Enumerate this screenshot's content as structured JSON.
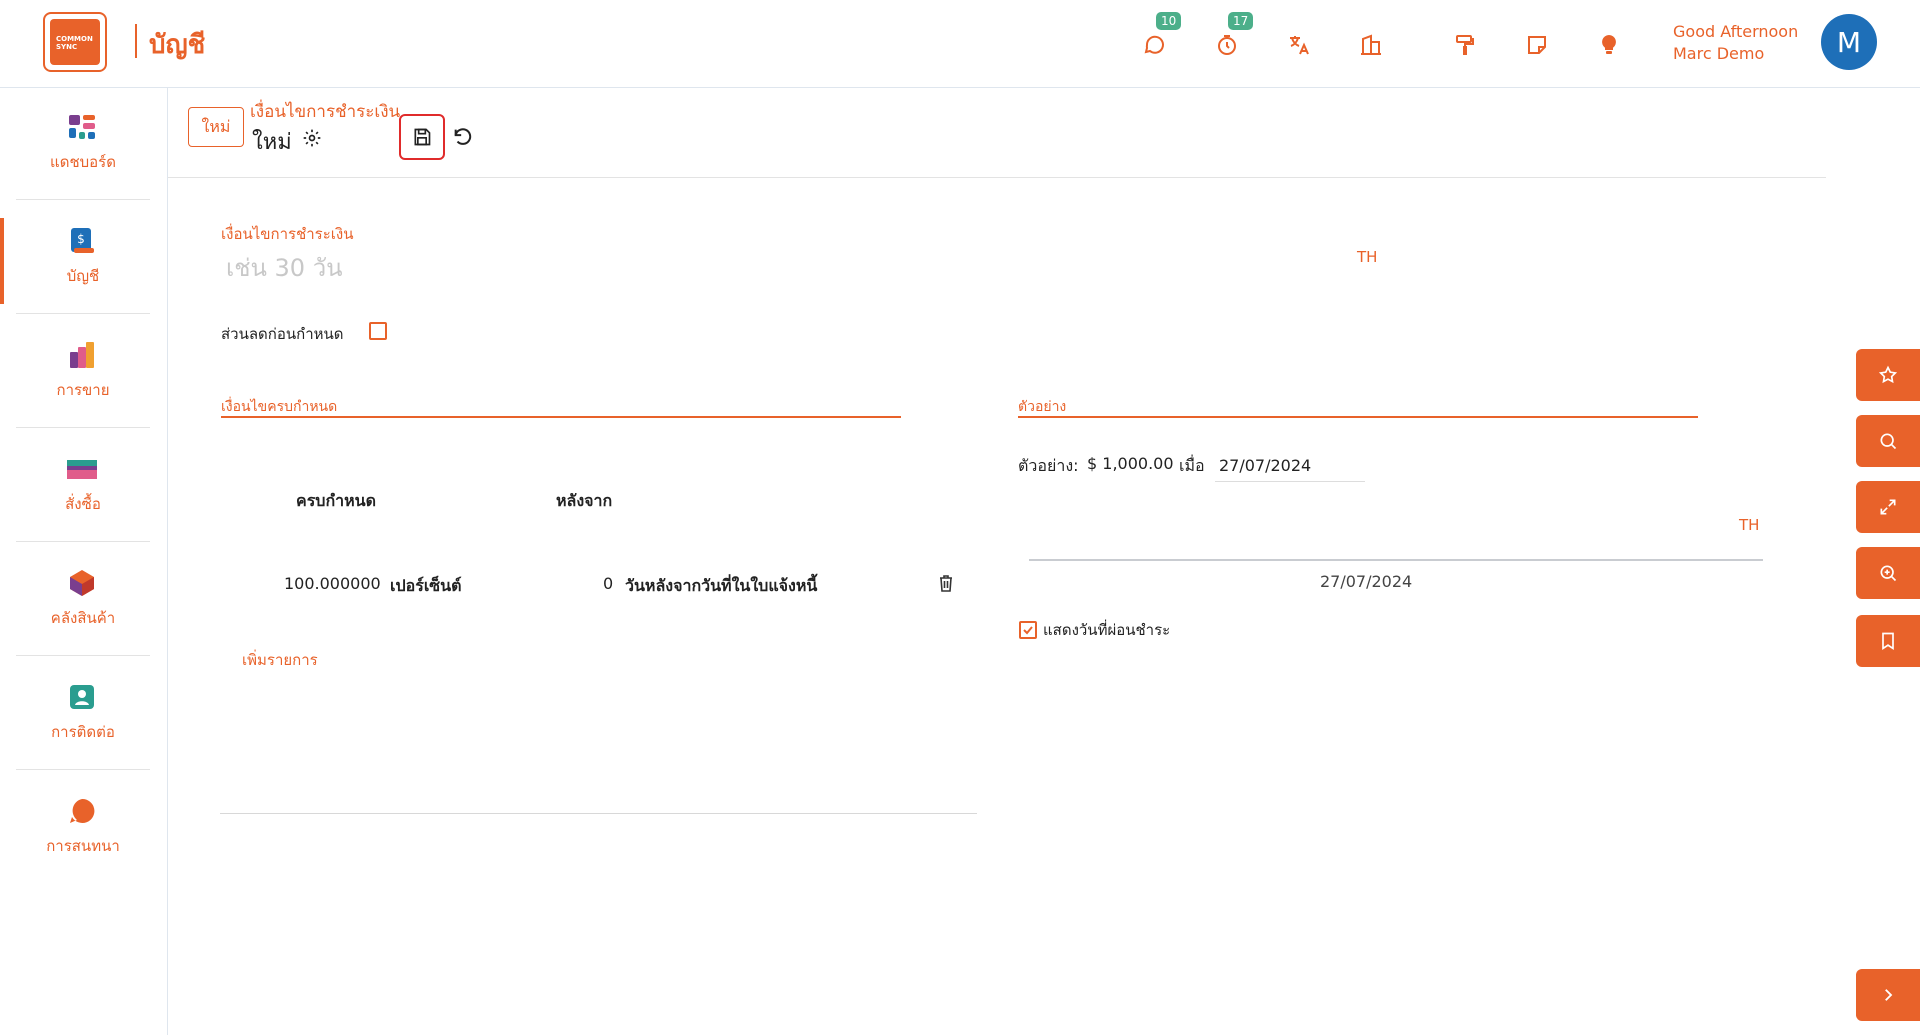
{
  "app": {
    "logo_text": "COMMON SYNC",
    "module_title": "บัญชี"
  },
  "topbar": {
    "icons": [
      {
        "name": "chat-icon",
        "badge": "10"
      },
      {
        "name": "timer-icon",
        "badge": "17"
      },
      {
        "name": "translate-icon",
        "badge": ""
      },
      {
        "name": "company-icon",
        "badge": ""
      },
      {
        "name": "paint-roller-icon",
        "badge": ""
      },
      {
        "name": "sticky-note-icon",
        "badge": ""
      },
      {
        "name": "lightbulb-icon",
        "badge": ""
      }
    ],
    "greeting": "Good Afternoon",
    "user_name": "Marc Demo",
    "avatar_letter": "M"
  },
  "sidebar": {
    "items": [
      {
        "label": "แดชบอร์ด",
        "icon": "dashboard-icon"
      },
      {
        "label": "บัญชี",
        "icon": "accounting-icon"
      },
      {
        "label": "การขาย",
        "icon": "sales-icon"
      },
      {
        "label": "สั่งซื้อ",
        "icon": "purchase-icon"
      },
      {
        "label": "คลังสินค้า",
        "icon": "inventory-icon"
      },
      {
        "label": "การติดต่อ",
        "icon": "contacts-icon"
      },
      {
        "label": "การสนทนา",
        "icon": "discuss-icon"
      }
    ]
  },
  "form_header": {
    "status": "ใหม่",
    "breadcrumb": "เงื่อนไขการชำระเงิน",
    "record_name": "ใหม่"
  },
  "form": {
    "payment_terms_label": "เงื่อนไขการชำระเงิน",
    "payment_terms_placeholder": "เช่น 30 วัน",
    "lang_tag": "TH",
    "early_discount_label": "ส่วนลดก่อนกำหนด",
    "due_terms_title": "เงื่อนไขครบกำหนด",
    "col_due": "ครบกำหนด",
    "col_after": "หลังจาก",
    "row": {
      "value": "100.000000",
      "unit": "เปอร์เซ็นต์",
      "days": "0",
      "after_text": "วันหลังจากวันที่ในใบแจ้งหนี้"
    },
    "add_line": "เพิ่มรายการ"
  },
  "example": {
    "title": "ตัวอย่าง",
    "prefix": "ตัวอย่าง:",
    "amount": "$ 1,000.00",
    "when": "เมื่อ",
    "date_value": "27/07/2024",
    "lang_tag": "TH",
    "timeline_date": "27/07/2024",
    "show_installments_label": "แสดงวันที่ผ่อนชำระ",
    "show_installments_checked": true
  },
  "right_tools": [
    "star-icon",
    "search-icon",
    "expand-icon",
    "zoom-icon",
    "bookmark-icon"
  ],
  "colors": {
    "accent": "#e8622a",
    "avatar": "#1e6fb8",
    "badge": "#4caf8a"
  }
}
